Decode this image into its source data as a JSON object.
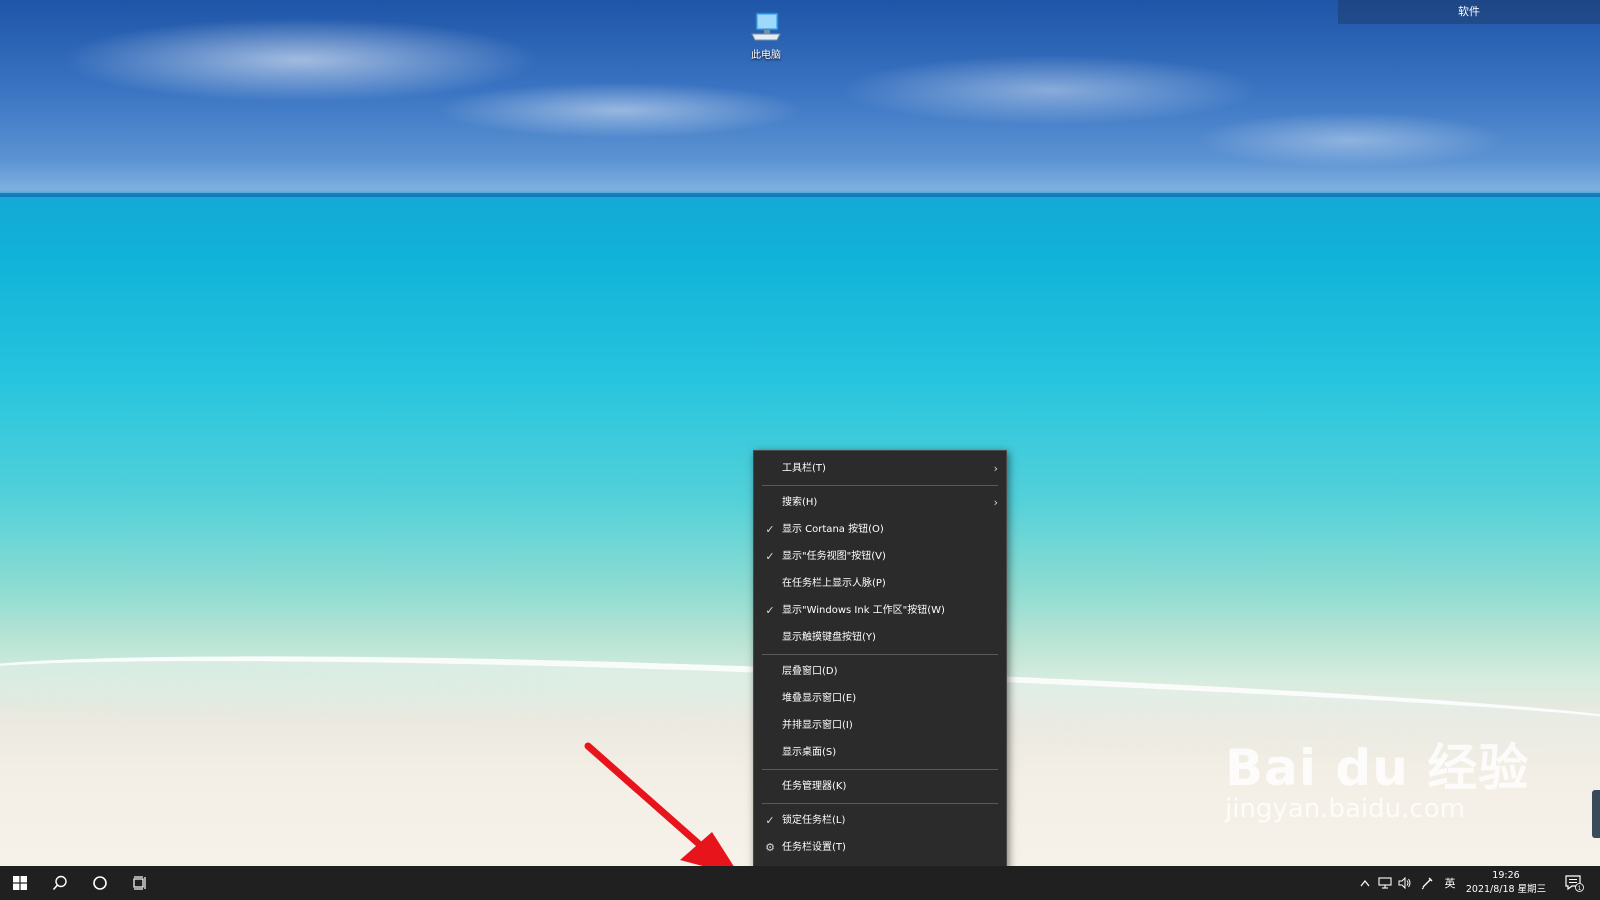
{
  "desktop": {
    "corner_label": "软件",
    "icons": [
      {
        "name": "computer-icon",
        "label": "此电脑"
      }
    ]
  },
  "context_menu": {
    "items": [
      {
        "label": "工具栏(T)",
        "checked": false,
        "submenu": true
      },
      {
        "separator": true
      },
      {
        "label": "搜索(H)",
        "checked": false,
        "submenu": true
      },
      {
        "label": "显示 Cortana 按钮(O)",
        "checked": true
      },
      {
        "label": "显示\"任务视图\"按钮(V)",
        "checked": true
      },
      {
        "label": "在任务栏上显示人脉(P)",
        "checked": false
      },
      {
        "label": "显示\"Windows Ink 工作区\"按钮(W)",
        "checked": true
      },
      {
        "label": "显示触摸键盘按钮(Y)",
        "checked": false
      },
      {
        "separator": true
      },
      {
        "label": "层叠窗口(D)",
        "checked": false
      },
      {
        "label": "堆叠显示窗口(E)",
        "checked": false
      },
      {
        "label": "并排显示窗口(I)",
        "checked": false
      },
      {
        "label": "显示桌面(S)",
        "checked": false
      },
      {
        "separator": true
      },
      {
        "label": "任务管理器(K)",
        "checked": false
      },
      {
        "separator": true
      },
      {
        "label": "锁定任务栏(L)",
        "checked": true
      },
      {
        "label": "任务栏设置(T)",
        "checked": false,
        "icon": "gear-icon"
      }
    ]
  },
  "taskbar": {
    "ime_label": "英",
    "time": "19:26",
    "date": "2021/8/18 星期三",
    "notification_count": "1"
  },
  "watermark": {
    "main": "Bai du 经验",
    "sub": "jingyan.baidu.com"
  },
  "colors": {
    "menu_bg": "#2b2b2b",
    "taskbar_bg": "#202020",
    "annotation": "#e8141b"
  }
}
